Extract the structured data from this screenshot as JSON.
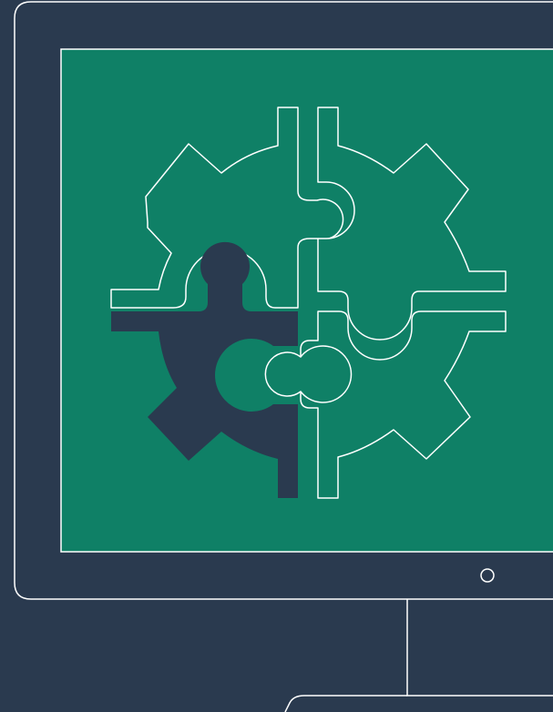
{
  "colors": {
    "background": "#2a3a4f",
    "screen": "#0f8066",
    "outline": "#ffffff",
    "highlight_piece": "#2a3a4f"
  },
  "icons": {
    "illustration": "gear-puzzle-icon",
    "monitor": "monitor-icon",
    "power": "power-button-icon"
  }
}
